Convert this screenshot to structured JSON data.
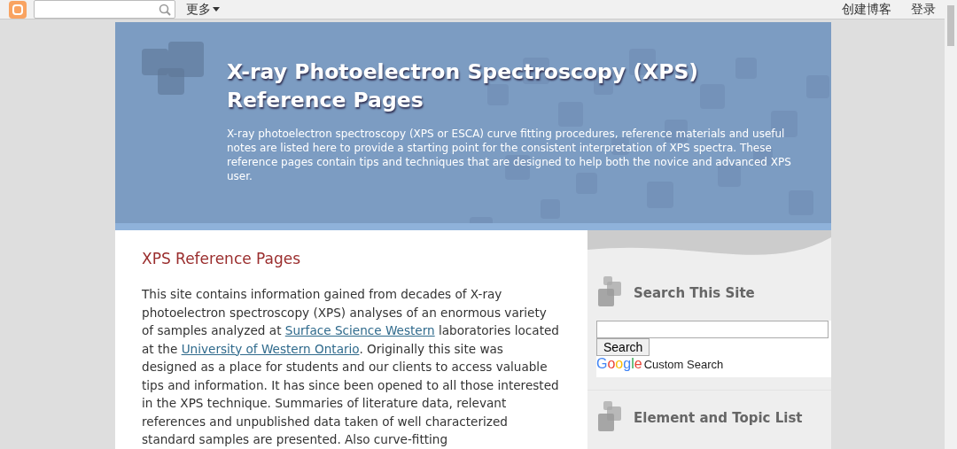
{
  "navbar": {
    "more": "更多",
    "links": [
      "创建博客",
      "登录"
    ]
  },
  "header": {
    "title": "X-ray Photoelectron Spectroscopy (XPS) Reference Pages",
    "description": "X-ray photoelectron spectroscopy (XPS or ESCA) curve fitting procedures, reference materials and useful notes are listed here to provide a starting point for the consistent interpretation of XPS spectra. These reference pages contain tips and techniques that are designed to help both the novice and advanced XPS user."
  },
  "main": {
    "title": "XPS Reference Pages",
    "paragraph": [
      {
        "kind": "text",
        "text": "This site contains information gained from decades of X-ray photoelectron spectroscopy (XPS) analyses of an enormous variety of samples analyzed at "
      },
      {
        "kind": "link",
        "text": "Surface Science Western"
      },
      {
        "kind": "text",
        "text": " laboratories located at the "
      },
      {
        "kind": "link",
        "text": "University of Western Ontario"
      },
      {
        "kind": "text",
        "text": ". Originally this site was designed as a place for students and our clients to access valuable tips and information. It has since been opened to all those interested in the XPS technique. Summaries of literature data, relevant references and unpublished data taken of well characterized standard samples are presented. Also curve-fitting"
      }
    ]
  },
  "sidebar": {
    "widgets": [
      {
        "kind": "search",
        "title": "Search This Site",
        "button": "Search",
        "logo": "Google",
        "logo_caption": "Custom Search"
      },
      {
        "kind": "text",
        "title": "Element and Topic List"
      }
    ]
  }
}
